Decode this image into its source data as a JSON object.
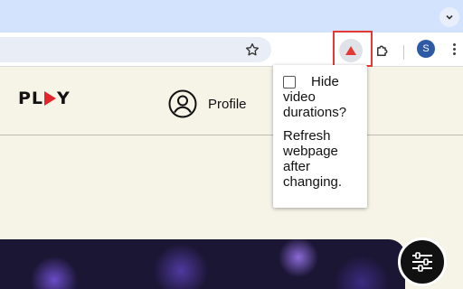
{
  "browser": {
    "extension_popup": {
      "checkbox_label_line1": "Hide",
      "checkbox_label_line2": "video",
      "checkbox_label_line3": "durations?",
      "checkbox_checked": false,
      "note_line1": "Refresh",
      "note_line2": "webpage",
      "note_line3": "after",
      "note_line4": "changing."
    },
    "profile_avatar_letter": "S",
    "accent_highlight": "#e53935",
    "extension_icon_color": "#e53935"
  },
  "site": {
    "logo_left": "PL",
    "logo_right": "Y",
    "profile_label": "Profile",
    "brand_red": "#e2242b"
  },
  "icons": [
    "chevron-down-icon",
    "star-icon",
    "warning-triangle-icon",
    "puzzle-icon",
    "kebab-menu-icon",
    "user-circle-icon",
    "sliders-icon"
  ]
}
